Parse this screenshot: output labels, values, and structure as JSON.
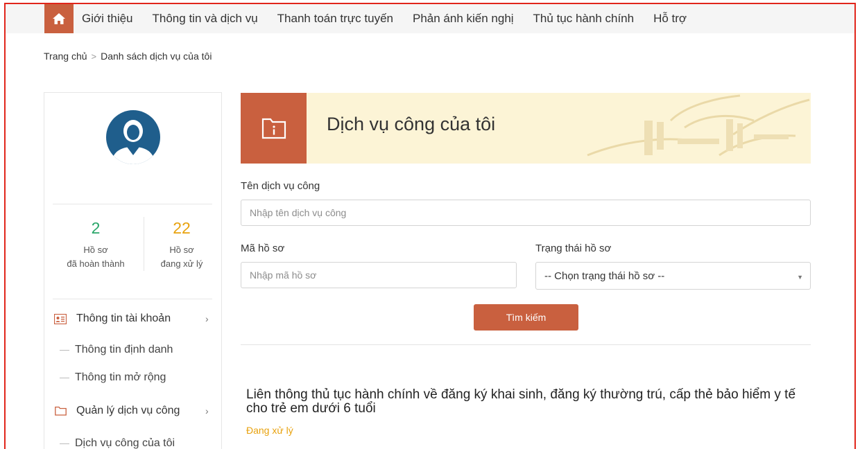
{
  "nav": {
    "items": [
      {
        "label": "Giới thiệu"
      },
      {
        "label": "Thông tin và dịch vụ"
      },
      {
        "label": "Thanh toán trực tuyến"
      },
      {
        "label": "Phản ánh kiến nghị"
      },
      {
        "label": "Thủ tục hành chính"
      },
      {
        "label": "Hỗ trợ"
      }
    ]
  },
  "breadcrumb": {
    "home": "Trang chủ",
    "separator": ">",
    "current": "Danh sách dịch vụ của tôi"
  },
  "sidebar": {
    "stats": [
      {
        "value": "2",
        "line1": "Hồ sơ",
        "line2": "đã hoàn thành",
        "color": "#2aa66a"
      },
      {
        "value": "22",
        "line1": "Hồ sơ",
        "line2": "đang xử lý",
        "color": "#e8a20e"
      }
    ],
    "menu": {
      "account": {
        "label": "Thông tin tài khoản",
        "sub": [
          "Thông tin định danh",
          "Thông tin mở rộng"
        ]
      },
      "services": {
        "label": "Quản lý dịch vụ công",
        "sub": [
          "Dịch vụ công của tôi"
        ]
      }
    }
  },
  "banner": {
    "title": "Dịch vụ công của tôi"
  },
  "form": {
    "service_name_label": "Tên dịch vụ công",
    "service_name_placeholder": "Nhập tên dịch vụ công",
    "code_label": "Mã hồ sơ",
    "code_placeholder": "Nhập mã hồ sơ",
    "status_label": "Trạng thái hồ sơ",
    "status_selected": "-- Chọn trạng thái hồ sơ --",
    "search_button": "Tìm kiếm"
  },
  "results": [
    {
      "title": "Liên thông thủ tục hành chính về đăng ký khai sinh, đăng ký thường trú, cấp thẻ bảo hiểm y tế cho trẻ em dưới 6 tuổi",
      "status": "Đang xử lý"
    }
  ],
  "colors": {
    "accent": "#c9603f",
    "frame": "#e1251b",
    "banner_bg": "#fcf4d6",
    "pending": "#e8a20e",
    "done": "#2aa66a",
    "avatar": "#1f5e8c"
  }
}
